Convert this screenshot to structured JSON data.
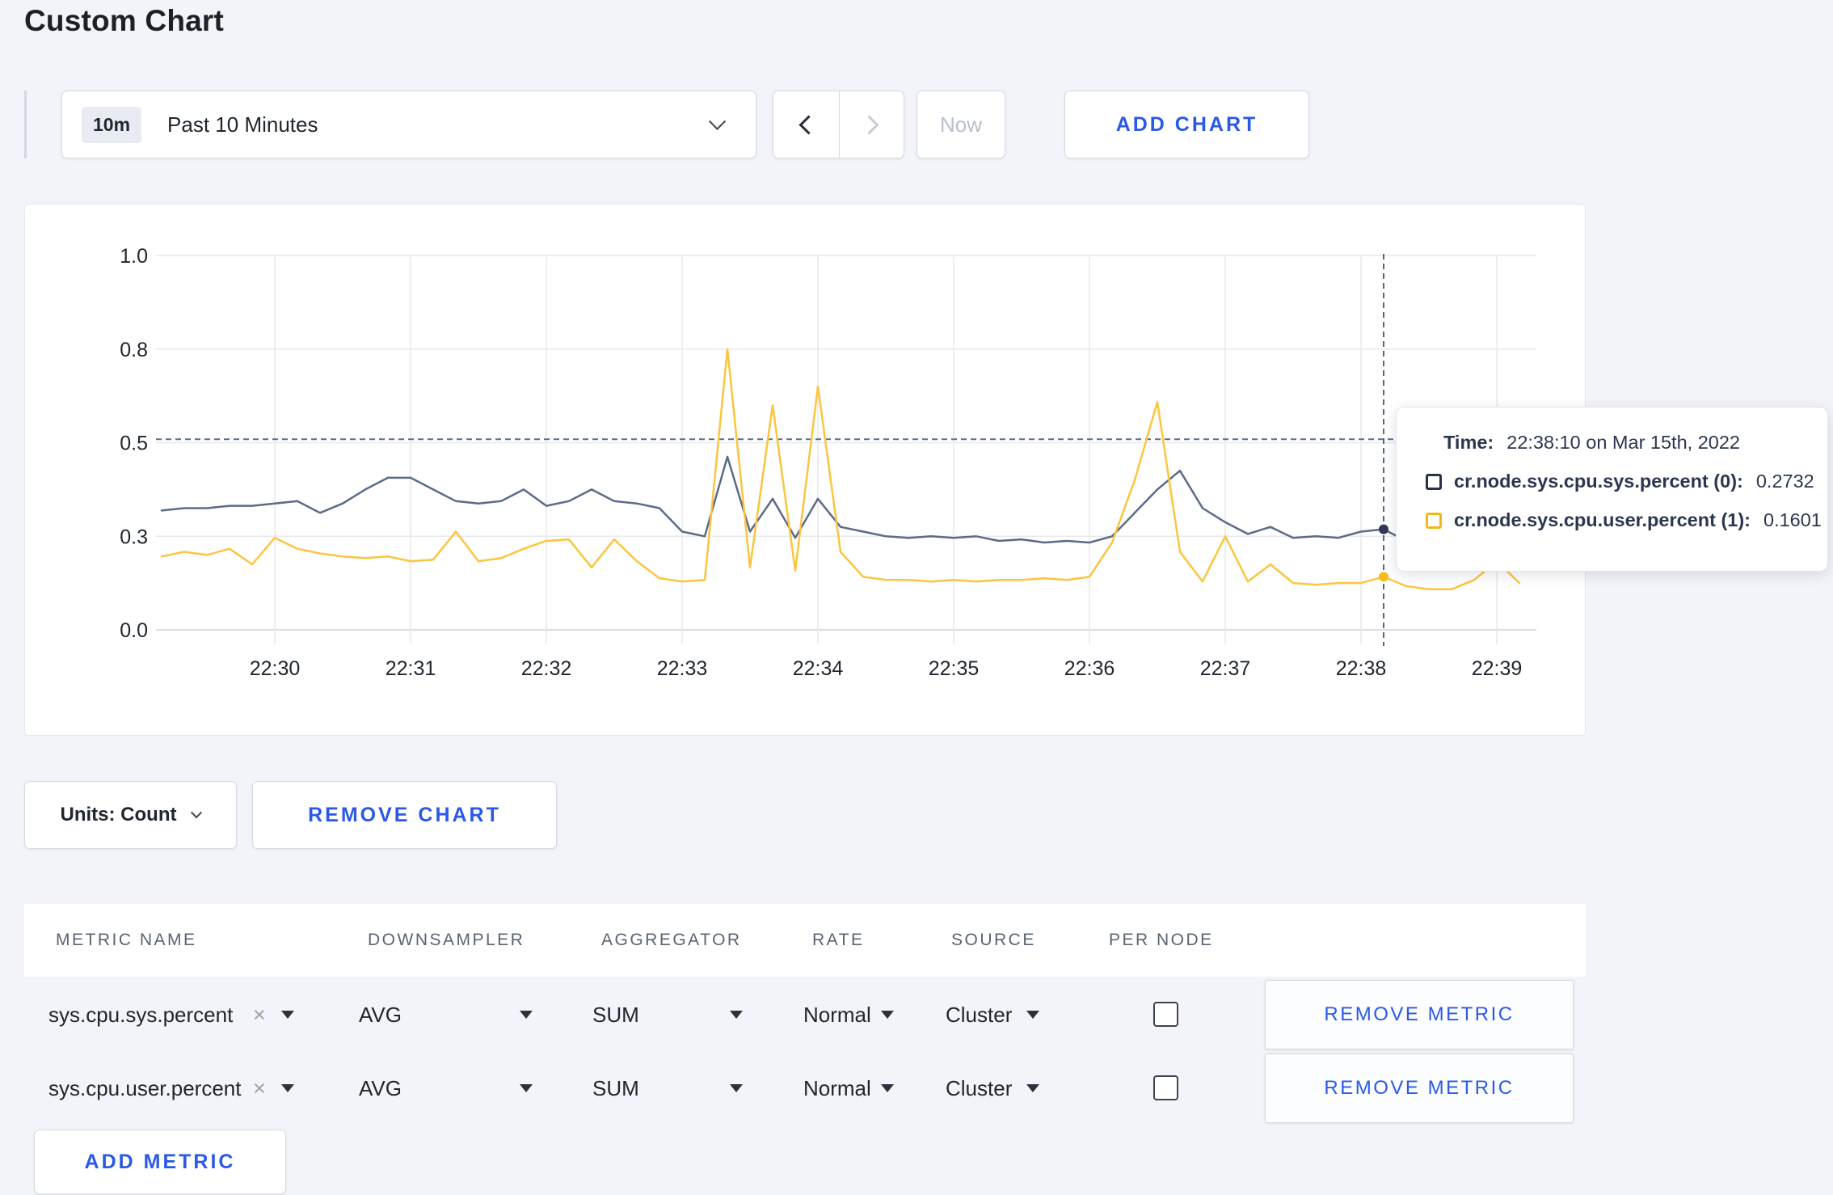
{
  "page": {
    "title": "Custom Chart"
  },
  "toolbar": {
    "range_badge": "10m",
    "range_label": "Past 10 Minutes",
    "now_label": "Now",
    "add_chart_label": "ADD CHART"
  },
  "chart_data": {
    "type": "line",
    "x_start": "22:29:10",
    "x_step_seconds": 10,
    "x_axis": {
      "tick_labels": [
        "22:30",
        "22:31",
        "22:32",
        "22:33",
        "22:34",
        "22:35",
        "22:36",
        "22:37",
        "22:38",
        "22:39"
      ]
    },
    "y_axis": {
      "tick_labels": [
        "0.0",
        "0.3",
        "0.5",
        "0.8",
        "1.0"
      ],
      "tick_values": [
        0,
        0.3,
        0.5,
        0.8,
        1.0
      ]
    },
    "grid": true,
    "legend": "none",
    "series": [
      {
        "name": "cr.node.sys.cpu.sys.percent",
        "color": "#5b6b88",
        "dot_color": "#2e3a55",
        "values": [
          0.355,
          0.36,
          0.36,
          0.365,
          0.365,
          0.37,
          0.375,
          0.35,
          0.37,
          0.4,
          0.425,
          0.425,
          0.4,
          0.375,
          0.37,
          0.375,
          0.4,
          0.365,
          0.375,
          0.4,
          0.375,
          0.37,
          0.36,
          0.31,
          0.3,
          0.47,
          0.31,
          0.38,
          0.295,
          0.38,
          0.32,
          0.31,
          0.3,
          0.295,
          0.3,
          0.295,
          0.3,
          0.285,
          0.29,
          0.28,
          0.285,
          0.28,
          0.3,
          0.35,
          0.4,
          0.44,
          0.36,
          0.33,
          0.305,
          0.32,
          0.295,
          0.3,
          0.295,
          0.31,
          0.315,
          0.285,
          0.295,
          0.3,
          0.305,
          0.31,
          0.295
        ]
      },
      {
        "name": "cr.node.sys.cpu.user.percent",
        "color": "#fcc53e",
        "dot_color": "#f5bd1e",
        "values": [
          0.235,
          0.25,
          0.24,
          0.26,
          0.21,
          0.295,
          0.26,
          0.245,
          0.235,
          0.23,
          0.235,
          0.22,
          0.225,
          0.31,
          0.22,
          0.23,
          0.26,
          0.285,
          0.29,
          0.2,
          0.29,
          0.22,
          0.165,
          0.155,
          0.16,
          0.8,
          0.2,
          0.62,
          0.19,
          0.68,
          0.25,
          0.17,
          0.16,
          0.16,
          0.155,
          0.16,
          0.155,
          0.16,
          0.16,
          0.165,
          0.16,
          0.17,
          0.28,
          0.42,
          0.63,
          0.25,
          0.155,
          0.3,
          0.155,
          0.21,
          0.15,
          0.145,
          0.15,
          0.15,
          0.17,
          0.14,
          0.13,
          0.13,
          0.16,
          0.22,
          0.15
        ]
      }
    ],
    "hover": {
      "index": 54,
      "time": "22:38:10",
      "guideline_value": 0.511
    }
  },
  "tooltip": {
    "time_label": "Time:",
    "time_value": "22:38:10 on Mar 15th, 2022",
    "rows": [
      {
        "label": "cr.node.sys.cpu.sys.percent (0):",
        "value": "0.2732",
        "color": "#263149"
      },
      {
        "label": "cr.node.sys.cpu.user.percent (1):",
        "value": "0.1601",
        "color": "#f3b818"
      }
    ]
  },
  "chart_footer": {
    "units_label": "Units: Count",
    "remove_chart_label": "REMOVE CHART"
  },
  "metrics_table": {
    "headers": [
      "METRIC NAME",
      "DOWNSAMPLER",
      "AGGREGATOR",
      "RATE",
      "SOURCE",
      "PER NODE"
    ],
    "rows": [
      {
        "metric": "sys.cpu.sys.percent",
        "remove_icon": "×",
        "downsampler": "AVG",
        "aggregator": "SUM",
        "rate": "Normal",
        "source": "Cluster",
        "per_node_checked": false,
        "remove_label": "REMOVE METRIC"
      },
      {
        "metric": "sys.cpu.user.percent",
        "remove_icon": "×",
        "downsampler": "AVG",
        "aggregator": "SUM",
        "rate": "Normal",
        "source": "Cluster",
        "per_node_checked": false,
        "remove_label": "REMOVE METRIC"
      }
    ],
    "add_metric_label": "ADD METRIC"
  }
}
